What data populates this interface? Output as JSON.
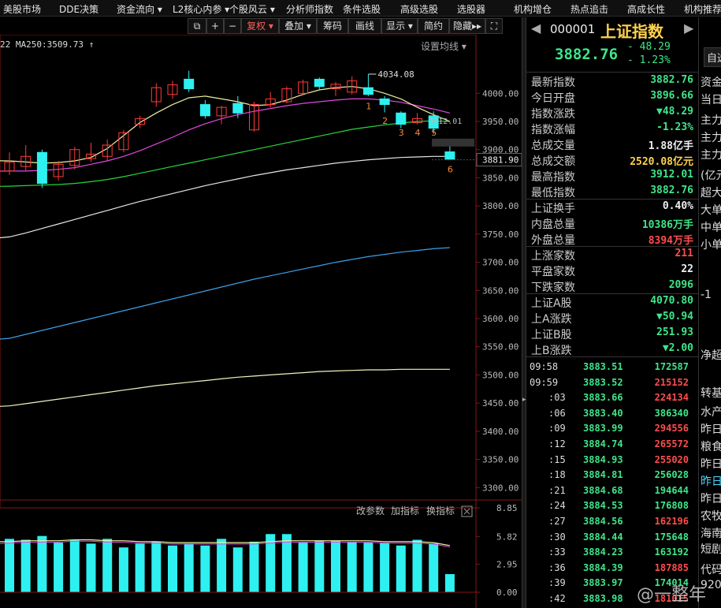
{
  "menu": [
    "美股市场",
    "DDE决策",
    "资金流向",
    "L2核心内参",
    "个股风云",
    "分析师指数",
    "条件选股",
    "高级选股",
    "选股器",
    "机构增仓",
    "热点追击",
    "高成长性",
    "机构推荐"
  ],
  "toolbar": {
    "restore": "复权",
    "overlay": "叠加",
    "chips": "筹码",
    "draw": "画线",
    "display": "显示",
    "simple": "简约",
    "hide": "隐藏"
  },
  "ma_readout": "22  MA250:3509.73",
  "settings_label": "设置均线",
  "sub_panel": {
    "change_param": "改参数",
    "add_indicator": "加指标",
    "switch_indicator": "换指标"
  },
  "quote": {
    "code": "000001",
    "name": "上证指数",
    "price": "3882.76",
    "change": "- 48.29",
    "change_pct": "- 1.23%",
    "tab_label": "自选",
    "rows1": [
      {
        "label": "最新指数",
        "value": "3882.76",
        "color": "green"
      },
      {
        "label": "今日开盘",
        "value": "3896.66",
        "color": "green"
      },
      {
        "label": "指数涨跌",
        "value": "▼48.29",
        "color": "green"
      },
      {
        "label": "指数涨幅",
        "value": "-1.23%",
        "color": "green"
      },
      {
        "label": "总成交量",
        "value": "1.88亿手",
        "color": "white"
      },
      {
        "label": "总成交额",
        "value": "2520.08亿元",
        "color": "yellow"
      },
      {
        "label": "最高指数",
        "value": "3912.01",
        "color": "green"
      },
      {
        "label": "最低指数",
        "value": "3882.76",
        "color": "green"
      }
    ],
    "rows2": [
      {
        "label": "上证换手",
        "value": "0.40%",
        "color": "white"
      },
      {
        "label": "内盘总量",
        "value": "10386万手",
        "color": "green"
      },
      {
        "label": "外盘总量",
        "value": "8394万手",
        "color": "red"
      }
    ],
    "rows3": [
      {
        "label": "上涨家数",
        "value": "211",
        "color": "red"
      },
      {
        "label": "平盘家数",
        "value": "22",
        "color": "white"
      },
      {
        "label": "下跌家数",
        "value": "2096",
        "color": "green"
      }
    ],
    "rows4": [
      {
        "label": "上证A股",
        "value": "4070.80",
        "color": "green"
      },
      {
        "label": "上A涨跌",
        "value": "▼50.94",
        "color": "green"
      },
      {
        "label": "上证B股",
        "value": "251.93",
        "color": "green"
      },
      {
        "label": "上B涨跌",
        "value": "▼2.00",
        "color": "green"
      }
    ],
    "ticks": [
      {
        "time": "09:58",
        "price": "3883.51",
        "vol": "172587",
        "color": "green"
      },
      {
        "time": "09:59",
        "price": "3883.52",
        "vol": "215152",
        "color": "red"
      },
      {
        "time": ":03",
        "price": "3883.66",
        "vol": "224134",
        "color": "red"
      },
      {
        "time": ":06",
        "price": "3883.40",
        "vol": "386340",
        "color": "green"
      },
      {
        "time": ":09",
        "price": "3883.99",
        "vol": "294556",
        "color": "red"
      },
      {
        "time": ":12",
        "price": "3884.74",
        "vol": "265572",
        "color": "red"
      },
      {
        "time": ":15",
        "price": "3884.93",
        "vol": "255020",
        "color": "red"
      },
      {
        "time": ":18",
        "price": "3884.81",
        "vol": "256028",
        "color": "green"
      },
      {
        "time": ":21",
        "price": "3884.68",
        "vol": "194644",
        "color": "green"
      },
      {
        "time": ":24",
        "price": "3884.53",
        "vol": "176808",
        "color": "green"
      },
      {
        "time": ":27",
        "price": "3884.56",
        "vol": "162196",
        "color": "red"
      },
      {
        "time": ":30",
        "price": "3884.44",
        "vol": "175648",
        "color": "green"
      },
      {
        "time": ":33",
        "price": "3884.23",
        "vol": "163192",
        "color": "green"
      },
      {
        "time": ":36",
        "price": "3884.39",
        "vol": "187885",
        "color": "red"
      },
      {
        "time": ":39",
        "price": "3883.97",
        "vol": "174014",
        "color": "green"
      },
      {
        "time": ":42",
        "price": "3883.98",
        "vol": "181015",
        "color": "red"
      }
    ]
  },
  "right_panel": [
    "资金",
    "当日",
    "主力",
    "主力",
    "主力",
    "(亿元",
    "超大",
    "大单",
    "中单",
    "小单",
    "-1",
    "净超",
    "转基",
    "水产",
    "昨日",
    "粮食",
    "昨日",
    "昨日",
    "昨日",
    "农牧",
    "海南",
    "短剧",
    "代码",
    "920"
  ],
  "watermark": "@一整年",
  "chart_data": {
    "type": "candlestick",
    "y_ticks": [
      4000,
      3950,
      3900,
      3850,
      3800,
      3750,
      3700,
      3650,
      3600,
      3550,
      3500,
      3450,
      3400,
      3350,
      3300
    ],
    "y_range": [
      3285,
      4090
    ],
    "price_box": "3881.90",
    "annotations": [
      "4034.08",
      "3912.01",
      "1",
      "2",
      "3",
      "4",
      "5",
      "6"
    ],
    "candles": [
      {
        "o": 3862,
        "c": 3878,
        "h": 3895,
        "l": 3855
      },
      {
        "o": 3870,
        "c": 3888,
        "h": 3908,
        "l": 3862
      },
      {
        "o": 3895,
        "c": 3840,
        "h": 3900,
        "l": 3832
      },
      {
        "o": 3852,
        "c": 3874,
        "h": 3880,
        "l": 3845
      },
      {
        "o": 3872,
        "c": 3900,
        "h": 3905,
        "l": 3865
      },
      {
        "o": 3884,
        "c": 3892,
        "h": 3912,
        "l": 3878
      },
      {
        "o": 3888,
        "c": 3908,
        "h": 3918,
        "l": 3880
      },
      {
        "o": 3900,
        "c": 3930,
        "h": 3935,
        "l": 3895
      },
      {
        "o": 3945,
        "c": 3955,
        "h": 3960,
        "l": 3938
      },
      {
        "o": 3985,
        "c": 4010,
        "h": 4018,
        "l": 3976
      },
      {
        "o": 3998,
        "c": 4015,
        "h": 4022,
        "l": 3990
      },
      {
        "o": 4025,
        "c": 4008,
        "h": 4040,
        "l": 4002
      },
      {
        "o": 3980,
        "c": 3960,
        "h": 3988,
        "l": 3955
      },
      {
        "o": 3960,
        "c": 3975,
        "h": 3978,
        "l": 3945
      },
      {
        "o": 3982,
        "c": 3965,
        "h": 3995,
        "l": 3956
      },
      {
        "o": 3935,
        "c": 3980,
        "h": 3985,
        "l": 3932
      },
      {
        "o": 3980,
        "c": 3990,
        "h": 4002,
        "l": 3975
      },
      {
        "o": 3985,
        "c": 4008,
        "h": 4012,
        "l": 3982
      },
      {
        "o": 4000,
        "c": 4020,
        "h": 4024,
        "l": 3996
      },
      {
        "o": 4025,
        "c": 4012,
        "h": 4028,
        "l": 4005
      },
      {
        "o": 4008,
        "c": 4016,
        "h": 4020,
        "l": 3995
      },
      {
        "o": 4002,
        "c": 4022,
        "h": 4030,
        "l": 3998
      },
      {
        "o": 4010,
        "c": 3998,
        "h": 4034,
        "l": 3995
      },
      {
        "o": 3990,
        "c": 3980,
        "h": 3995,
        "l": 3966
      },
      {
        "o": 3965,
        "c": 3945,
        "h": 3968,
        "l": 3938
      },
      {
        "o": 3948,
        "c": 3955,
        "h": 3965,
        "l": 3945
      },
      {
        "o": 3960,
        "c": 3938,
        "h": 3968,
        "l": 3928
      },
      {
        "o": 3896,
        "c": 3883,
        "h": 3912,
        "l": 3882
      }
    ],
    "ma5": [
      3880,
      3878,
      3876,
      3877,
      3880,
      3886,
      3902,
      3925,
      3948,
      3965,
      3980,
      3992,
      3995,
      3990,
      3985,
      3978,
      3980,
      3988,
      3998,
      4006,
      4010,
      4012,
      4008,
      4000,
      3990,
      3975,
      3962,
      3950
    ],
    "ma10": [
      3862,
      3862,
      3863,
      3865,
      3868,
      3874,
      3880,
      3888,
      3898,
      3910,
      3922,
      3935,
      3946,
      3955,
      3962,
      3968,
      3973,
      3978,
      3982,
      3985,
      3988,
      3990,
      3990,
      3988,
      3984,
      3978,
      3972,
      3965
    ],
    "ma20": [
      3835,
      3836,
      3837,
      3838,
      3840,
      3843,
      3847,
      3852,
      3858,
      3864,
      3870,
      3876,
      3882,
      3888,
      3894,
      3900,
      3906,
      3912,
      3918,
      3924,
      3930,
      3936,
      3940,
      3944,
      3947,
      3950,
      3951,
      3950
    ],
    "ma60": [
      3745,
      3752,
      3760,
      3768,
      3776,
      3784,
      3792,
      3800,
      3808,
      3815,
      3822,
      3829,
      3836,
      3842,
      3848,
      3854,
      3859,
      3864,
      3868,
      3872,
      3876,
      3879,
      3882,
      3884,
      3886,
      3887,
      3888,
      3888
    ],
    "ma120": [
      3565,
      3572,
      3579,
      3586,
      3593,
      3600,
      3607,
      3614,
      3621,
      3628,
      3635,
      3642,
      3649,
      3656,
      3663,
      3670,
      3676,
      3682,
      3688,
      3694,
      3700,
      3705,
      3710,
      3714,
      3718,
      3721,
      3724,
      3726
    ],
    "ma250": [
      3445,
      3449,
      3453,
      3457,
      3461,
      3465,
      3469,
      3473,
      3477,
      3481,
      3484,
      3487,
      3490,
      3493,
      3496,
      3498,
      3500,
      3502,
      3504,
      3506,
      3507,
      3508,
      3509,
      3509,
      3510,
      3510,
      3510,
      3510
    ],
    "volume": {
      "y_ticks": [
        "8.85",
        "5.82",
        "2.95",
        "0.00"
      ],
      "bars": [
        5.6,
        5.5,
        5.9,
        5.2,
        5.5,
        5.1,
        5.6,
        4.7,
        5.1,
        5.3,
        4.9,
        5.1,
        4.9,
        5.6,
        4.7,
        5.3,
        6.1,
        6.1,
        5.2,
        5.4,
        5.4,
        5.3,
        5.2,
        5.2,
        4.9,
        5.5,
        5.1,
        1.9
      ],
      "ma": [
        5.3,
        5.4,
        5.4,
        5.4,
        5.5,
        5.5,
        5.4,
        5.4,
        5.3,
        5.3,
        5.2,
        5.2,
        5.2,
        5.2,
        5.2,
        5.2,
        5.3,
        5.4,
        5.4,
        5.4,
        5.4,
        5.4,
        5.4,
        5.3,
        5.3,
        5.3,
        5.2,
        4.9
      ]
    }
  }
}
